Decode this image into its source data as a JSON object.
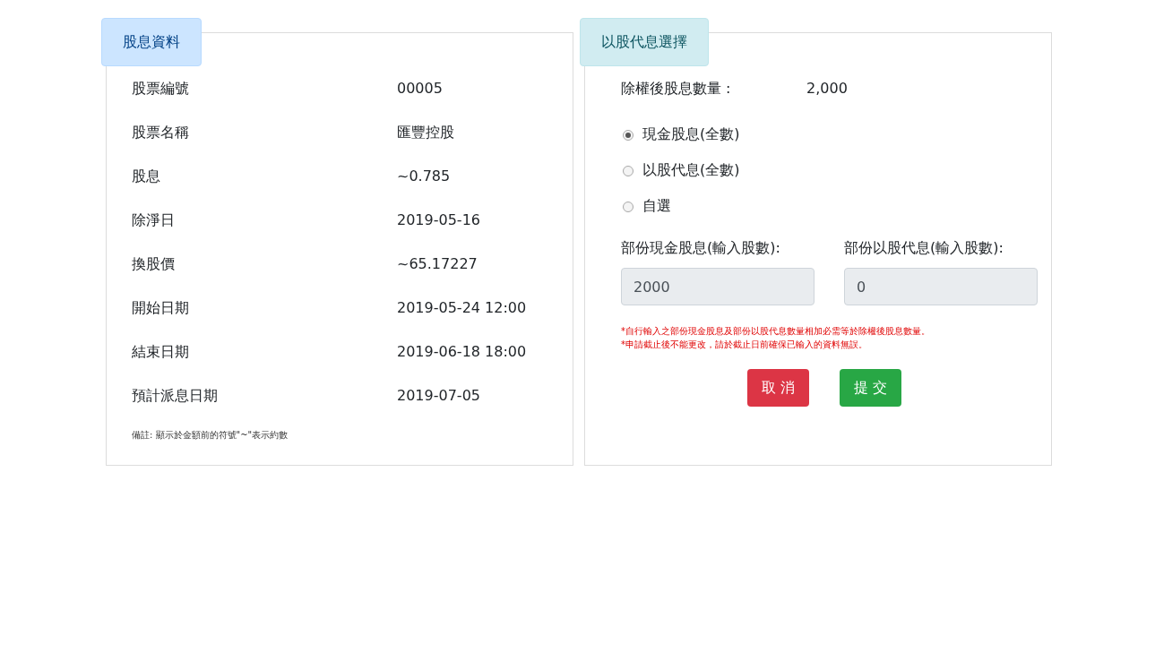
{
  "dividend_info": {
    "legend": "股息資料",
    "rows": [
      {
        "label": "股票編號",
        "value": "00005"
      },
      {
        "label": "股票名稱",
        "value": "匯豐控股"
      },
      {
        "label": "股息",
        "value": "~0.785"
      },
      {
        "label": "除淨日",
        "value": "2019-05-16"
      },
      {
        "label": "換股價",
        "value": "~65.17227"
      },
      {
        "label": "開始日期",
        "value": "2019-05-24 12:00"
      },
      {
        "label": "結束日期",
        "value": "2019-06-18 18:00"
      },
      {
        "label": "預計派息日期",
        "value": "2019-07-05"
      }
    ],
    "note": "備註: 顯示於金額前的符號\"~\"表示約數"
  },
  "scrip_choice": {
    "legend": "以股代息選擇",
    "total": {
      "label": "除權後股息數量 :",
      "value": "2,000"
    },
    "options": [
      {
        "label": "現金股息(全數)",
        "selected": true
      },
      {
        "label": "以股代息(全數)",
        "selected": false
      },
      {
        "label": "自選",
        "selected": false
      }
    ],
    "fields": [
      {
        "label": "部份現金股息(輸入股數):",
        "value": "2000",
        "disabled": true
      },
      {
        "label": "部份以股代息(輸入股數):",
        "value": "0",
        "disabled": true
      }
    ],
    "notes": [
      "*自行輸入之部份現金股息及部份以股代息數量相加必需等於除權後股息數量。",
      "*申請截止後不能更改，請於截止日前確保已輸入的資料無誤。"
    ],
    "buttons": [
      {
        "label": "取 消",
        "kind": "cancel"
      },
      {
        "label": "提 交",
        "kind": "submit"
      }
    ]
  }
}
